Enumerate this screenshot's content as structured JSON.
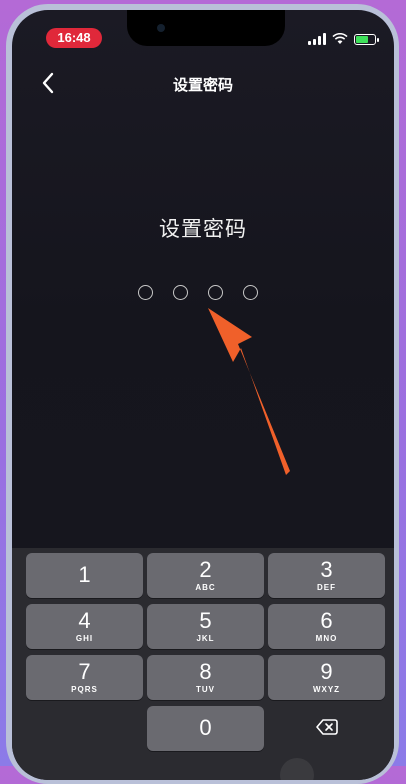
{
  "status_bar": {
    "time": "16:48"
  },
  "nav": {
    "back_icon": "chevron-left-icon",
    "title": "设置密码"
  },
  "main": {
    "prompt": "设置密码",
    "pin_length": 4,
    "pin_entered": 0
  },
  "keypad": {
    "keys": [
      {
        "num": "1",
        "letters": ""
      },
      {
        "num": "2",
        "letters": "ABC"
      },
      {
        "num": "3",
        "letters": "DEF"
      },
      {
        "num": "4",
        "letters": "GHI"
      },
      {
        "num": "5",
        "letters": "JKL"
      },
      {
        "num": "6",
        "letters": "MNO"
      },
      {
        "num": "7",
        "letters": "PQRS"
      },
      {
        "num": "8",
        "letters": "TUV"
      },
      {
        "num": "9",
        "letters": "WXYZ"
      },
      {
        "num": "0",
        "letters": ""
      }
    ],
    "delete_icon": "backspace-icon"
  },
  "colors": {
    "accent_arrow": "#f0602a",
    "time_pill": "#e0283a"
  }
}
